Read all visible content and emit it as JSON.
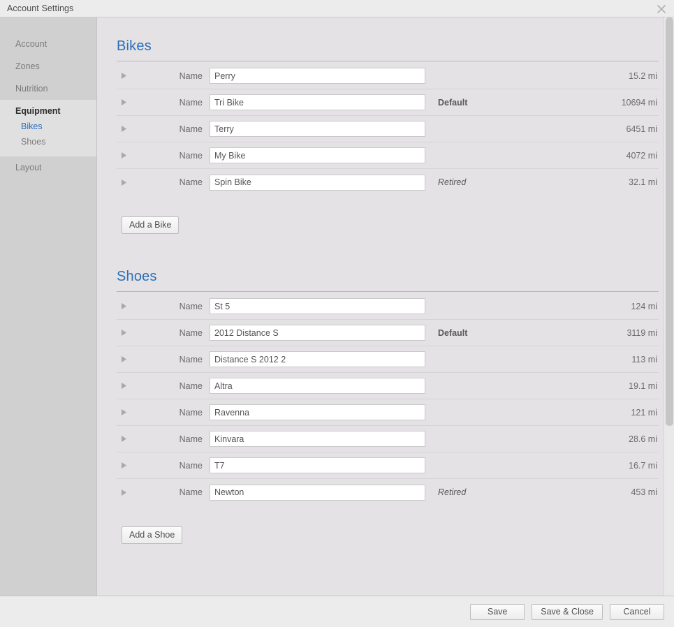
{
  "window": {
    "title": "Account Settings",
    "close_icon": "close-icon"
  },
  "sidebar": {
    "items": [
      {
        "label": "Account",
        "type": "item"
      },
      {
        "label": "Zones",
        "type": "item"
      },
      {
        "label": "Nutrition",
        "type": "item"
      },
      {
        "label": "Equipment",
        "type": "item-bold"
      },
      {
        "label": "Bikes",
        "type": "sub-active"
      },
      {
        "label": "Shoes",
        "type": "sub"
      },
      {
        "label": "Layout",
        "type": "item"
      }
    ]
  },
  "content": {
    "bikes": {
      "title": "Bikes",
      "name_label": "Name",
      "add_button": "Add a Bike",
      "rows": [
        {
          "name": "Perry",
          "status": "",
          "distance": "15.2 mi"
        },
        {
          "name": "Tri Bike",
          "status": "Default",
          "distance": "10694 mi"
        },
        {
          "name": "Terry",
          "status": "",
          "distance": "6451 mi"
        },
        {
          "name": "My Bike",
          "status": "",
          "distance": "4072 mi"
        },
        {
          "name": "Spin Bike",
          "status": "Retired",
          "distance": "32.1 mi"
        }
      ]
    },
    "shoes": {
      "title": "Shoes",
      "name_label": "Name",
      "add_button": "Add a Shoe",
      "rows": [
        {
          "name": "St 5",
          "status": "",
          "distance": "124 mi"
        },
        {
          "name": "2012 Distance S",
          "status": "Default",
          "distance": "3119 mi"
        },
        {
          "name": "Distance S 2012 2",
          "status": "",
          "distance": "113 mi"
        },
        {
          "name": "Altra",
          "status": "",
          "distance": "19.1 mi"
        },
        {
          "name": "Ravenna",
          "status": "",
          "distance": "121 mi"
        },
        {
          "name": "Kinvara",
          "status": "",
          "distance": "28.6 mi"
        },
        {
          "name": "T7",
          "status": "",
          "distance": "16.7 mi"
        },
        {
          "name": "Newton",
          "status": "Retired",
          "distance": "453 mi"
        }
      ]
    }
  },
  "footer": {
    "save_label": "Save",
    "save_close_label": "Save & Close",
    "cancel_label": "Cancel"
  },
  "colors": {
    "accent_blue": "#2a6fbb",
    "sidebar_bg": "#d0d0d0",
    "content_bg": "#e4e2e4",
    "chrome_bg": "#ececec"
  }
}
